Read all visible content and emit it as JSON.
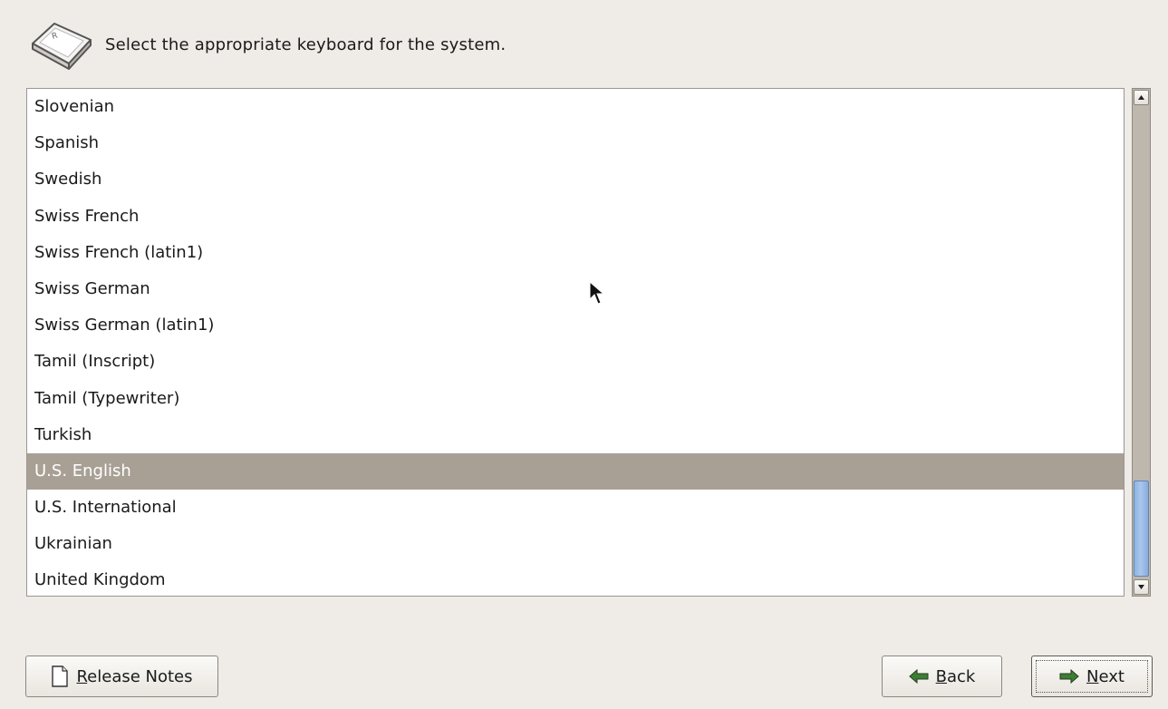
{
  "header": {
    "icon": "keyboard-key-icon",
    "text": "Select the appropriate keyboard for the system."
  },
  "keyboard_list": {
    "items": [
      "Slovenian",
      "Spanish",
      "Swedish",
      "Swiss French",
      "Swiss French (latin1)",
      "Swiss German",
      "Swiss German (latin1)",
      "Tamil (Inscript)",
      "Tamil (Typewriter)",
      "Turkish",
      "U.S. English",
      "U.S. International",
      "Ukrainian",
      "United Kingdom"
    ],
    "selected": "U.S. English"
  },
  "buttons": {
    "release_notes": {
      "mnemonic": "R",
      "rest": "elease Notes",
      "icon": "document-icon"
    },
    "back": {
      "mnemonic": "B",
      "rest": "ack",
      "icon": "arrow-left-icon"
    },
    "next": {
      "mnemonic": "N",
      "rest": "ext",
      "icon": "arrow-right-icon"
    }
  },
  "colors": {
    "selection": "#a8a095",
    "scroll_thumb": "#a9c7ee",
    "background": "#efebe6"
  }
}
